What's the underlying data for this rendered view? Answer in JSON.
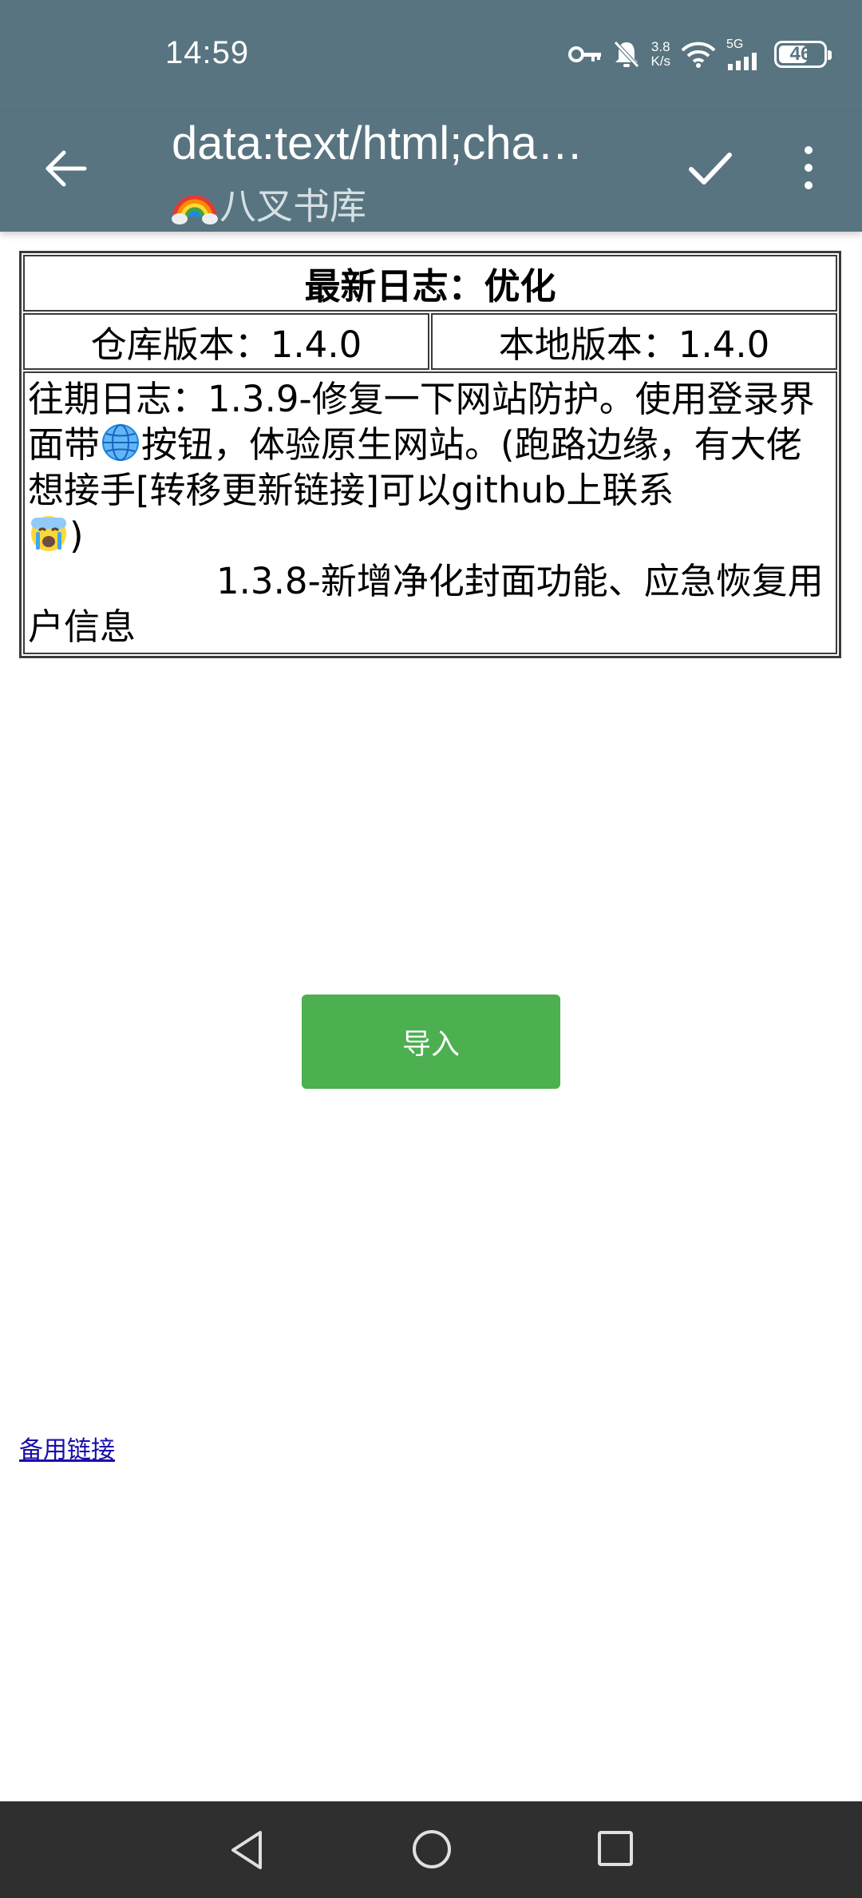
{
  "status_bar": {
    "time": "14:59",
    "net_speed_value": "3.8",
    "net_speed_unit": "K/s",
    "signal_label": "5G",
    "battery_level": "46",
    "icons": [
      "key-icon",
      "bell-muted-icon",
      "wifi-icon",
      "signal-icon",
      "battery-icon"
    ]
  },
  "app_bar": {
    "url": "data:text/html;charset=utf-8,…",
    "url_display": "data:text/html;cha…",
    "subtitle": "八叉书库",
    "icons": [
      "back-arrow-icon",
      "checkmark-icon",
      "more-vert-icon",
      "rainbow-icon"
    ]
  },
  "log": {
    "heading": "最新日志：优化",
    "repo_version": "仓库版本：1.4.0",
    "local_version": "本地版本：1.4.0",
    "history_part1": "往期日志：1.3.9-修复一下网站防护。使用登录界面带",
    "history_part2": "按钮，体验原生网站。(跑路边缘，有大佬想接手[转移更新链接]可以github上联系",
    "history_part3": ")",
    "history_part4": "1.3.8-新增净化封面功能、应急恢复用户信息",
    "emojis": [
      "globe-icon",
      "crying-face-icon"
    ]
  },
  "actions": {
    "import_label": "导入",
    "backup_link_label": "备用链接",
    "import_color": "#4caf50"
  },
  "nav_bar": {
    "icons": [
      "nav-back-icon",
      "nav-home-icon",
      "nav-recents-icon"
    ]
  },
  "colors": {
    "app_bar_bg": "#587480",
    "link": "#1a0dab",
    "nav_bar_bg": "#2f2f2f"
  }
}
